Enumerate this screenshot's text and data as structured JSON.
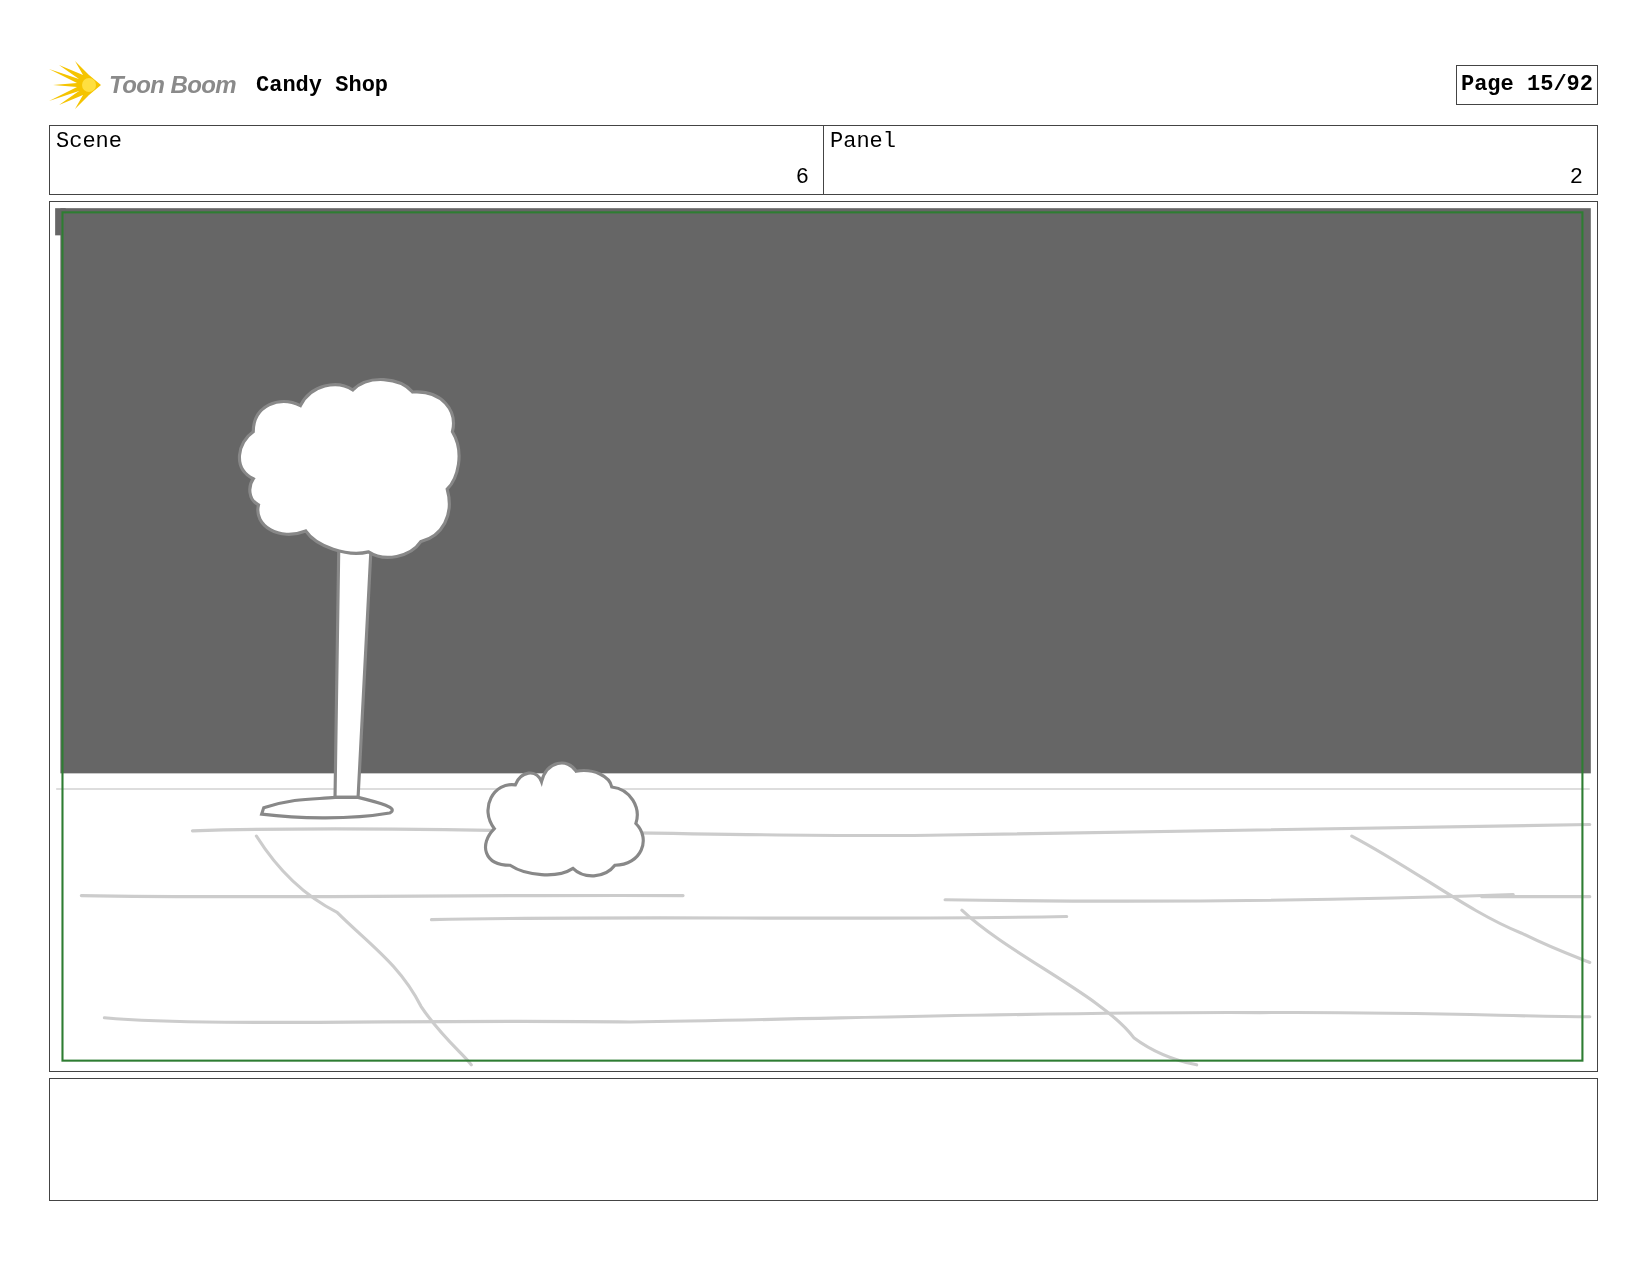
{
  "header": {
    "logo_text": "Toon Boom",
    "project": "Candy Shop",
    "page": "Page 15/92"
  },
  "fields": [
    {
      "label": "Scene",
      "value": "6"
    },
    {
      "label": "Panel",
      "value": "2"
    }
  ]
}
